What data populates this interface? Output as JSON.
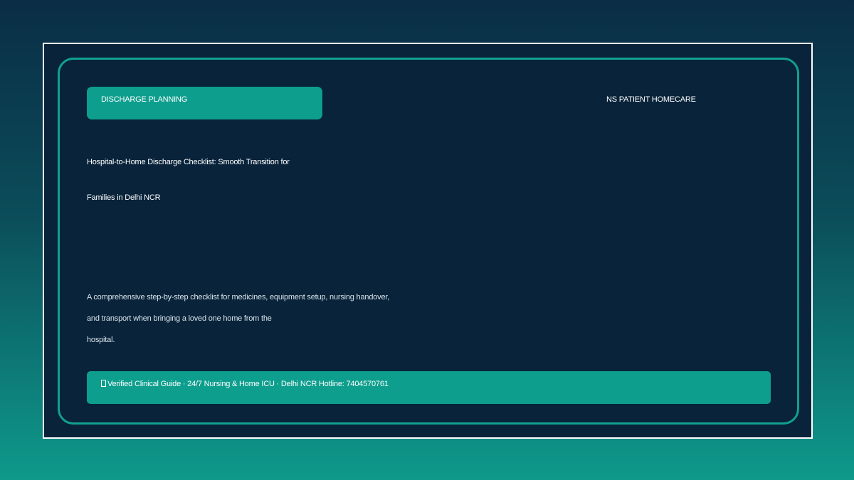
{
  "tag": {
    "label": "DISCHARGE PLANNING"
  },
  "brand": {
    "name": "NS PATIENT HOMECARE"
  },
  "title": {
    "line1": "Hospital-to-Home Discharge Checklist: Smooth Transition for",
    "line2": "Families in Delhi NCR"
  },
  "description": {
    "line1": "A comprehensive step-by-step checklist for medicines, equipment setup, nursing handover,",
    "line2": "and transport when bringing a loved one home from the",
    "line3": "hospital."
  },
  "footer": {
    "icon": "check-box-icon",
    "text": "Verified Clinical Guide · 24/7 Nursing & Home ICU · Delhi NCR Hotline: 7404570761"
  },
  "colors": {
    "background_top": "#0a2d45",
    "background_bottom": "#0e9a8b",
    "card": "#08233a",
    "accent": "#0e9e8e",
    "border": "#12a08f"
  }
}
